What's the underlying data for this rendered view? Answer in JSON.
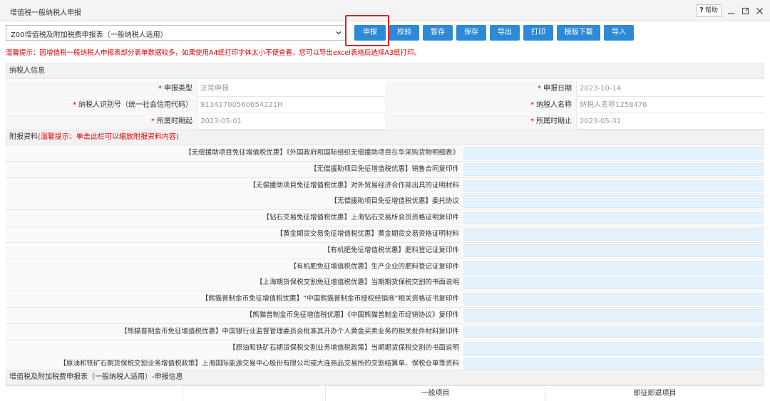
{
  "window": {
    "title": "增值税一般纳税人申报",
    "help_label": "帮助"
  },
  "toolbar": {
    "form_select": "Z00增值税及附加税费申报表（一般纳税人适用）",
    "buttons": [
      "申报",
      "校验",
      "暂存",
      "保存",
      "导出",
      "打印",
      "模版下载",
      "导入"
    ]
  },
  "warning": "温馨提示：因增值税一般纳税人申报表部分表单数据较多，如果使用A4纸打印字体太小不便查看，您可以导出excel表格后选择A3纸打印。",
  "taxpayer": {
    "section_title": "纳税人信息",
    "declare_type_label": "申报类型",
    "declare_type_value": "正常申报",
    "declare_date_label": "申报日期",
    "declare_date_value": "2023-10-14",
    "tax_id_label": "纳税人识别号（统一社会信用代码）",
    "tax_id_value": "91341700560654221H",
    "taxpayer_name_label": "纳税人名称",
    "taxpayer_name_value": "纳税人名称1258476",
    "period_start_label": "所属时期起",
    "period_start_value": "2023-05-01",
    "period_end_label": "所属时期止",
    "period_end_value": "2023-05-31"
  },
  "attachments": {
    "section_title": "附报资料",
    "section_hint": "(温馨提示：单击此栏可以缩放附报资料内容)",
    "items": [
      "【无偿援助项目免征增值税优惠】《外国政府和国际组织无偿援助项目在华采购货物明细表》",
      "【无偿援助项目免征增值税优惠】销售合同复印件",
      "【无偿援助项目免征增值税优惠】对外贸易经济合作部出具的证明材料",
      "【无偿援助项目免征增值税优惠】委托协议",
      "【钻石交易免征增值税优惠】上海钻石交易所会员资格证明复印件",
      "【黄金期货交易免征增值税优惠】黄金期货交易资格证明材料",
      "【有机肥免征增值税优惠】肥料登记证复印件",
      "【有机肥免征增值税优惠】生产企业的肥料登记证复印件",
      "【上海期货保税交割免征增值税优惠】当期期货保税交割的书面说明",
      "【熊猫普制金币免征增值税优惠】“中国熊猫普制金币授权经销商”相关资格证书复印件",
      "【熊猫普制金币免征增值税优惠】《中国熊猫普制金币经销协议》复印件",
      "【熊猫普制金币免征增值税优惠】中国银行业监督管理委员会批准其开办个人黄金买卖业务的相关批件材料复印件",
      "【原油和铁矿石期货保税交割业务增值税政策】当期期货保税交割的书面说明",
      "【原油和铁矿石期货保税交割业务增值税政策】上海国际能源交易中心股份有限公司或大连商品交易所的交割结算单、保税仓单等资料"
    ]
  },
  "report_info": {
    "section_title": "增值税及附加税费申报表（一般纳税人适用）-申报信息",
    "col_general": "一般项目",
    "col_immediate": "即征即退项目"
  }
}
